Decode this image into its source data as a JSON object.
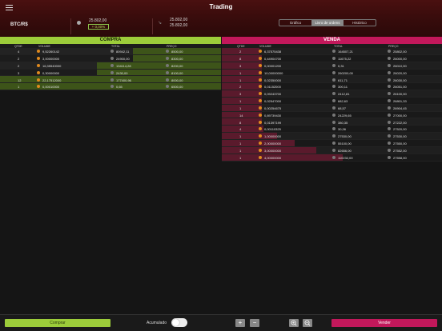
{
  "app": {
    "title": "Trading"
  },
  "ticker": {
    "pair": "BTC/R$",
    "last_price": "25.802,00",
    "change": "+ 0,00%",
    "bid": "25.802,00",
    "ask": "25.802,00"
  },
  "tabs": [
    {
      "label": "Gráfico"
    },
    {
      "label": "Livro de ordens",
      "active": true
    },
    {
      "label": "Histórico"
    }
  ],
  "buy": {
    "title": "COMPRA",
    "columns": [
      "QTDE",
      "VOLUME",
      "TOTAL",
      "PREÇO"
    ],
    "rows": [
      {
        "qtde": "4",
        "volume": "9,52260142",
        "total": "80942,11",
        "preco": "8500,00",
        "depth": 0.4
      },
      {
        "qtde": "2",
        "volume": "3,00000000",
        "total": "24900,00",
        "preco": "8300,00",
        "depth": 0.4
      },
      {
        "qtde": "2",
        "volume": "16,35540000",
        "total": "134114,28",
        "preco": "8200,00",
        "depth": 0.56
      },
      {
        "qtde": "3",
        "volume": "0,30000000",
        "total": "2430,00",
        "preco": "8100,00",
        "depth": 0.56
      },
      {
        "qtde": "12",
        "volume": "22,17512000",
        "total": "177400,96",
        "preco": "8000,00",
        "depth": 1.0
      },
      {
        "qtde": "1",
        "volume": "0,00010000",
        "total": "0,65",
        "preco": "6500,00",
        "depth": 1.0
      }
    ]
  },
  "sell": {
    "title": "VENDA",
    "columns": [
      "QTDE",
      "VOLUME",
      "TOTAL",
      "PREÇO"
    ],
    "rows": [
      {
        "qtde": "2",
        "volume": "6,37575438",
        "total": "164507,21",
        "preco": "25802,00",
        "depth": 0.17
      },
      {
        "qtde": "8",
        "volume": "0,44904700",
        "total": "11675,22",
        "preco": "26000,00",
        "depth": 0.18
      },
      {
        "qtde": "3",
        "volume": "0,00001200",
        "total": "0,31",
        "preco": "26010,00",
        "depth": 0.18
      },
      {
        "qtde": "1",
        "volume": "10,00000000",
        "total": "260200,00",
        "preco": "26020,00",
        "depth": 0.18
      },
      {
        "qtde": "1",
        "volume": "0,02350000",
        "total": "611,71",
        "preco": "26030,00",
        "depth": 0.18
      },
      {
        "qtde": "2",
        "volume": "0,01152000",
        "total": "300,11",
        "preco": "26051,00",
        "depth": 0.18
      },
      {
        "qtde": "3",
        "volume": "0,09243700",
        "total": "2412,81",
        "preco": "26100,00",
        "depth": 0.18
      },
      {
        "qtde": "1",
        "volume": "0,02547000",
        "total": "682,63",
        "preco": "26801,33",
        "depth": 0.18
      },
      {
        "qtde": "1",
        "volume": "0,00254675",
        "total": "68,57",
        "preco": "26904,45",
        "depth": 0.18
      },
      {
        "qtde": "14",
        "volume": "0,89739430",
        "total": "24229,65",
        "preco": "27000,00",
        "depth": 0.18
      },
      {
        "qtde": "8",
        "volume": "0,01397199",
        "total": "380,35",
        "preco": "27222,00",
        "depth": 0.18
      },
      {
        "qtde": "4",
        "volume": "0,00110325",
        "total": "30,36",
        "preco": "27520,00",
        "depth": 0.19
      },
      {
        "qtde": "1",
        "volume": "1,00000000",
        "total": "27530,00",
        "preco": "27530,00",
        "depth": 0.25
      },
      {
        "qtde": "1",
        "volume": "2,00000000",
        "total": "55100,00",
        "preco": "27550,00",
        "depth": 0.33
      },
      {
        "qtde": "1",
        "volume": "3,00000000",
        "total": "82656,00",
        "preco": "27552,00",
        "depth": 0.43
      },
      {
        "qtde": "1",
        "volume": "4,00000000",
        "total": "110232,00",
        "preco": "27558,00",
        "depth": 0.55
      }
    ]
  },
  "footer": {
    "buy_label": "Comprar",
    "accumulated_label": "Acumulado",
    "sell_label": "Vender",
    "plus": "+",
    "minus": "−"
  },
  "colors": {
    "buy": "#9ccc3a",
    "sell": "#c2185b",
    "btc_icon": "#e08a1e"
  },
  "icons": [
    "menu-icon",
    "coin-icon",
    "spread-icon",
    "btc-icon",
    "brl-icon",
    "zoom-in-icon",
    "zoom-out-icon"
  ]
}
